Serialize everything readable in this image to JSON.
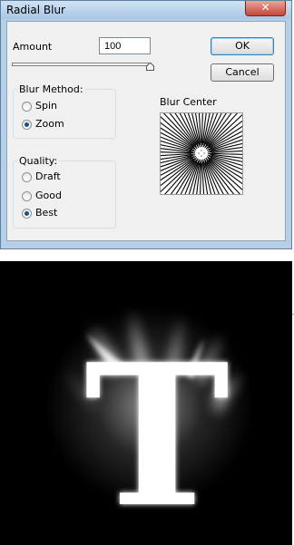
{
  "dialog": {
    "title": "Radial Blur",
    "close_glyph": "✕",
    "amount": {
      "label": "Amount",
      "value": "100",
      "slider_fraction": 1.0
    },
    "buttons": {
      "ok": "OK",
      "cancel": "Cancel"
    },
    "blur_method": {
      "title": "Blur Method:",
      "options": [
        {
          "label": "Spin",
          "selected": false
        },
        {
          "label": "Zoom",
          "selected": true
        }
      ]
    },
    "quality": {
      "title": "Quality:",
      "options": [
        {
          "label": "Draft",
          "selected": false
        },
        {
          "label": "Good",
          "selected": false
        },
        {
          "label": "Best",
          "selected": true
        }
      ]
    },
    "blur_center": {
      "label": "Blur Center"
    }
  },
  "preview": {
    "letter": "T"
  },
  "colors": {
    "window_frame": "#b7cfe6",
    "close_button": "#c3473a",
    "radio_selected": "#1c5180",
    "photo_background": "#000000"
  }
}
